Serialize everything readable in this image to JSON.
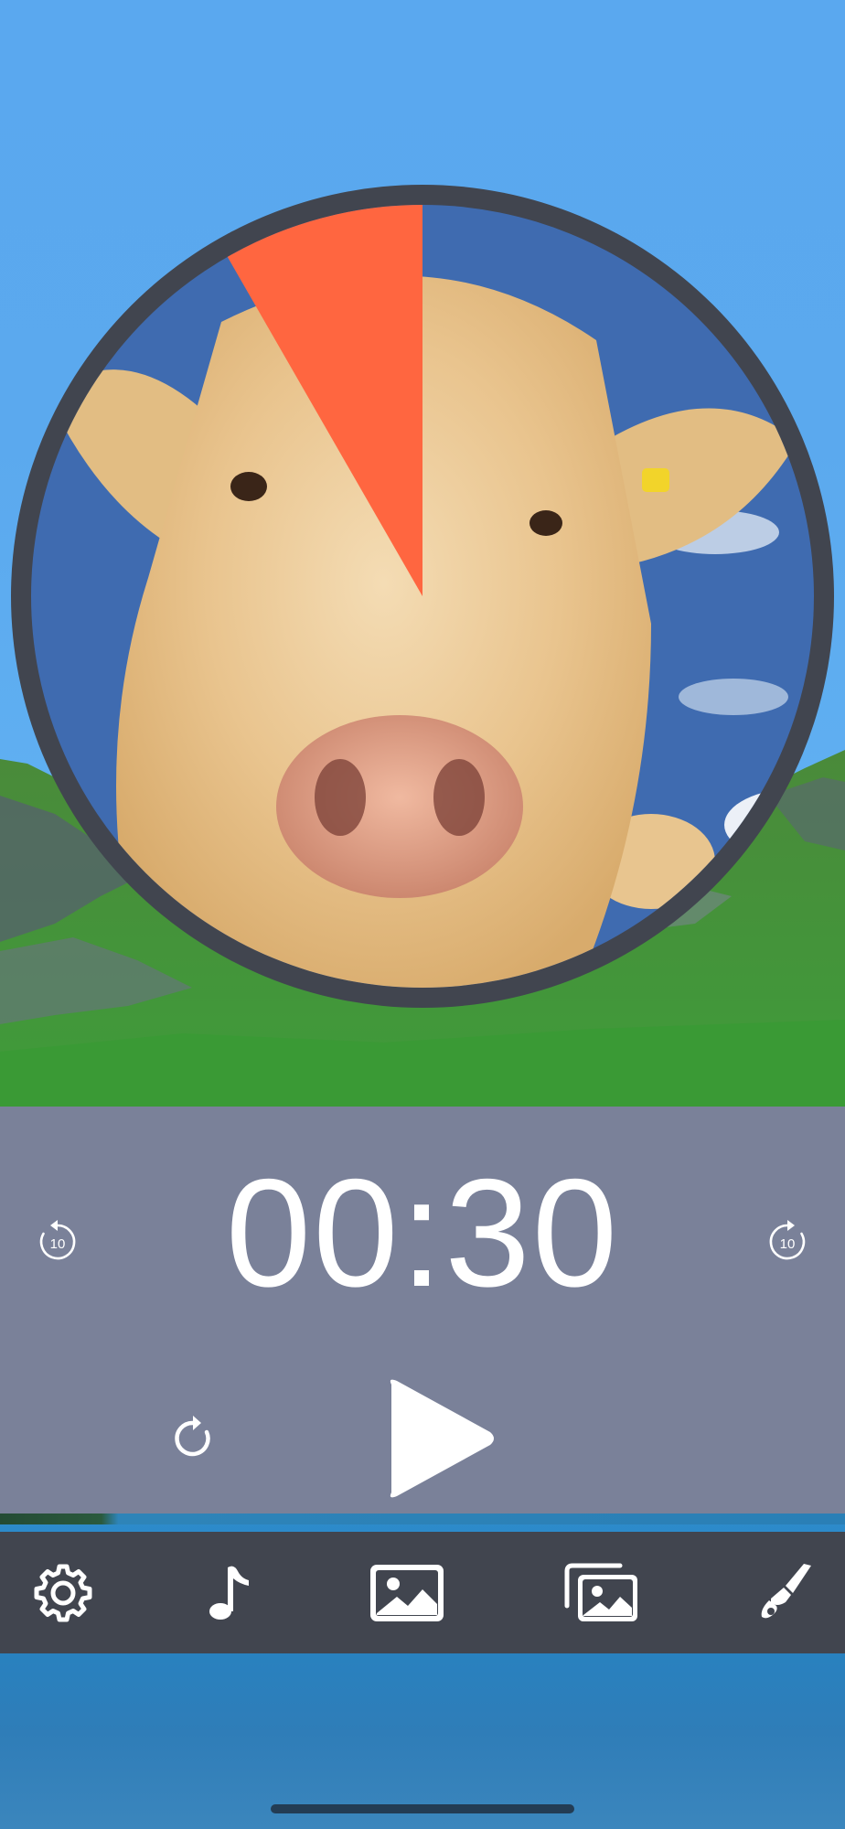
{
  "timer": {
    "display": "00:30",
    "progress_fraction": 0.083,
    "dial_image": "cow-photo",
    "remaining_color": "#ff6640",
    "ring_color": "#41454f"
  },
  "controls": {
    "skip_back_label": "10",
    "skip_forward_label": "10",
    "reset_icon": "reset-icon",
    "play_icon": "play-icon"
  },
  "toolbar": {
    "items": [
      {
        "icon": "gear-icon",
        "name": "settings"
      },
      {
        "icon": "music-note-icon",
        "name": "sound"
      },
      {
        "icon": "image-icon",
        "name": "background-image"
      },
      {
        "icon": "images-icon",
        "name": "image-gallery"
      },
      {
        "icon": "paintbrush-icon",
        "name": "theme"
      }
    ]
  },
  "colors": {
    "panel": "#7a8199",
    "toolbar": "#41454f",
    "text": "#ffffff"
  }
}
